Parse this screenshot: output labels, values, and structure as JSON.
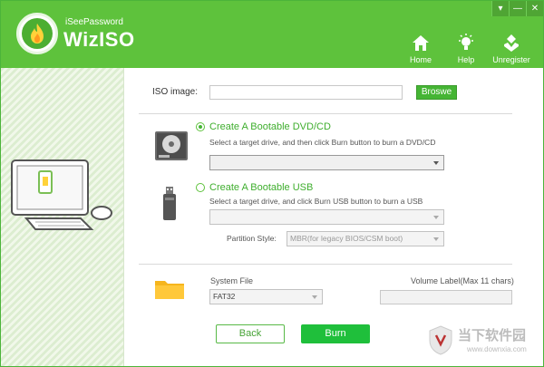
{
  "window": {
    "brand_small": "iSeePassword",
    "brand_name": "WizISO",
    "controls": [
      "▾",
      "—",
      "✕"
    ]
  },
  "nav": {
    "home": "Home",
    "help": "Help",
    "unregister": "Unregister"
  },
  "iso": {
    "label": "ISO image:",
    "value": "",
    "browse_label": "Broswe"
  },
  "dvd": {
    "title": "Create A Bootable DVD/CD",
    "hint": "Select a target drive, and then click Burn button to burn a DVD/CD",
    "selected": true,
    "drive_value": ""
  },
  "usb": {
    "title": "Create A Bootable USB",
    "hint": "Select a target drive, and click Burn USB button to burn a USB",
    "selected": false,
    "drive_value": "",
    "partition_label": "Partition Style:",
    "partition_value": "MBR(for legacy BIOS/CSM boot)"
  },
  "fs": {
    "system_file_label": "System File",
    "system_file_value": "FAT32",
    "volume_label": "Volume Label(Max 11 chars)",
    "volume_value": ""
  },
  "actions": {
    "back_label": "Back",
    "burn_label": "Burn"
  },
  "watermark": {
    "cn_text": "当下软件园",
    "url": "www.downxia.com"
  },
  "colors": {
    "header_green": "#5ec23c",
    "accent_green": "#45b534",
    "burn_green": "#1fbf3b"
  }
}
